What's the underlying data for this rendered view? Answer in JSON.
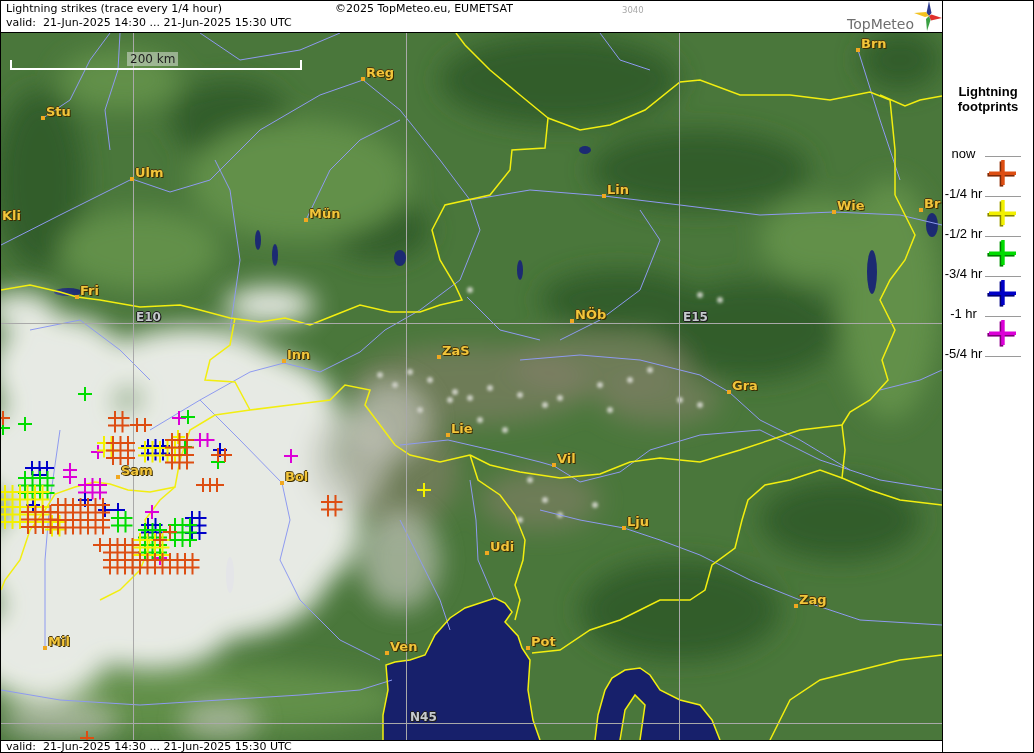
{
  "header": {
    "title": "Lightning strikes (trace every 1/4 hour)",
    "copyright": "©2025 TopMeteo.eu, EUMETSAT",
    "code": "3040",
    "valid": "valid:  21-Jun-2025 14:30 ... 21-Jun-2025 15:30 UTC",
    "logo": "TopMeteo"
  },
  "map": {
    "scale": "200 km",
    "grid_labels": [
      "E10",
      "E15",
      "N45"
    ],
    "cities": [
      "Brn",
      "Reg",
      "Stu",
      "Ulm",
      "Lin",
      "Br",
      "Wie",
      "Kli",
      "Mün",
      "Fri",
      "NÖb",
      "ZaS",
      "Inn",
      "Gra",
      "Lie",
      "Vil",
      "Sam",
      "Bol",
      "Lju",
      "Udi",
      "Zag",
      "Mil",
      "Pot",
      "Ven"
    ]
  },
  "legend": {
    "title": "Lightning footprints",
    "ticks": [
      "now",
      "-1/4 hr",
      "-1/2 hr",
      "-3/4 hr",
      "-1 hr",
      "-5/4 hr"
    ],
    "periods": [
      {
        "color": "#dd4e12"
      },
      {
        "color": "#f2f000"
      },
      {
        "color": "#00dc00"
      },
      {
        "color": "#0000c8"
      },
      {
        "color": "#dc00d8"
      }
    ]
  },
  "footer": {
    "valid": "valid:  21-Jun-2025 14:30 ... 21-Jun-2025 15:30 UTC"
  }
}
